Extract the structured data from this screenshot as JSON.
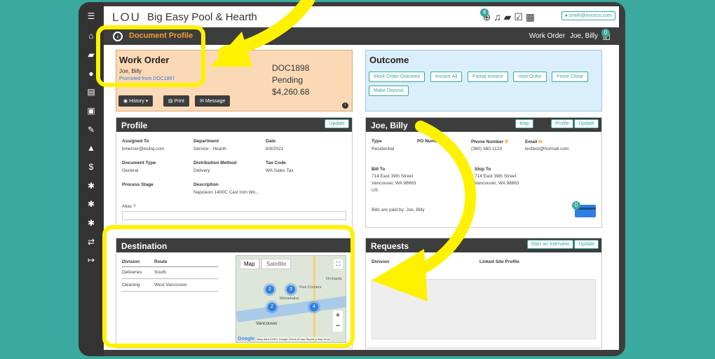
{
  "app": {
    "logo": "LOU",
    "name": "Big Easy Pool & Hearth",
    "user": "smith@evosus.com",
    "notification_count": "4"
  },
  "subbar": {
    "title": "Document Profile",
    "crumb_type": "Work Order",
    "crumb_name": "Joe, Billy",
    "check_count": "0"
  },
  "work_order": {
    "title": "Work Order",
    "customer": "Joe, Billy",
    "promoted": "Promoted from DOC1897",
    "doc": "DOC1898",
    "status": "Pending",
    "amount": "$4,260.68",
    "buttons": {
      "history": "History",
      "print": "Print",
      "message": "Message"
    }
  },
  "outcome": {
    "title": "Outcome",
    "buttons": [
      "Work Order Outcome",
      "Invoice All",
      "Partial Invoice",
      "Void Order",
      "Force Close",
      "Make Deposit"
    ]
  },
  "profile": {
    "title": "Profile",
    "update": "Update",
    "fields": {
      "assigned_to_label": "Assigned To",
      "assigned_to": "bmercer@louhq.com",
      "department_label": "Department",
      "department": "Service - Hearth",
      "date_label": "Date",
      "date": "6/9/2021",
      "doc_type_label": "Document Type",
      "doc_type": "General",
      "dist_label": "Distribution Method",
      "dist": "Delivery",
      "tax_label": "Tax Code",
      "tax": "WA Sales Tax",
      "stage_label": "Process Stage",
      "desc_label": "Description",
      "desc": "Napoleon 1400C Cast Iron Wo...",
      "alias_label": "Alias"
    }
  },
  "customer": {
    "title": "Joe, Billy",
    "map": "Map",
    "profile": "Profile",
    "update": "Update",
    "type_label": "Type",
    "type": "Residential",
    "po_label": "PO Number",
    "phone_label": "Phone Number",
    "phone": "(360) 360-1123",
    "email_label": "Email",
    "email": "testtest@hotmail.com",
    "bill_label": "Bill To",
    "bill_1": "714 East 39th Street",
    "bill_2": "Vancouver, WA 98663",
    "bill_3": "US",
    "ship_label": "Ship To",
    "ship_1": "714 East 39th Street",
    "ship_2": "Vancouver, WA 98663",
    "paid_by": "Bills are paid by: Joe, Billy",
    "card_count": "0"
  },
  "destination": {
    "title": "Destination",
    "col_division": "Division",
    "col_route": "Route",
    "rows": [
      {
        "division": "Deliveries",
        "route": "South"
      },
      {
        "division": "Cleaning",
        "route": "West Vancouver"
      }
    ],
    "map_tab": "Map",
    "satellite_tab": "Satellite",
    "clusters": [
      "2",
      "3",
      "2",
      "4"
    ],
    "places": {
      "five_corners": "Five Corners",
      "minnehaha": "Minnehaha",
      "vancouver": "Vancouver",
      "orchards": "Orchards"
    },
    "attrib": "Map data ©2021 Google  Terms of Use  Report a map error",
    "google": "Google"
  },
  "requests": {
    "title": "Requests",
    "interview": "Start an Interview",
    "update": "Update",
    "division_label": "Division",
    "linked_label": "Linked Site Profile"
  }
}
